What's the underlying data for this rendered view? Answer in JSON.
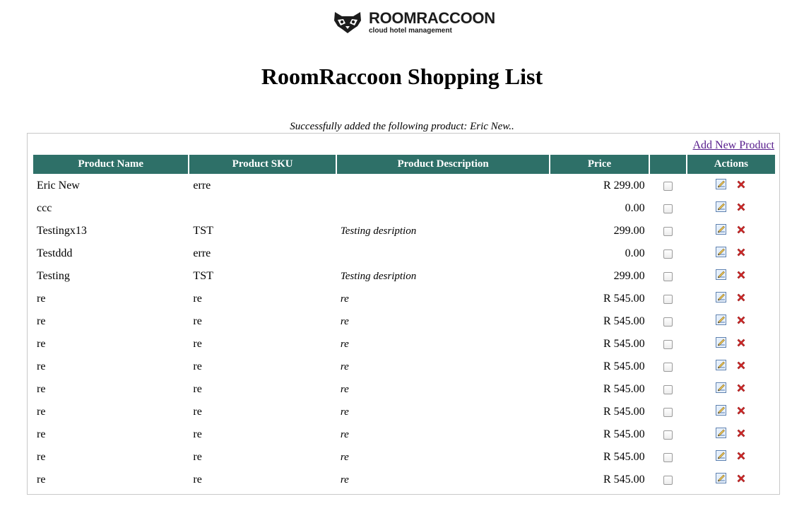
{
  "brand": {
    "name": "ROOMRACCOON",
    "tagline": "cloud hotel management"
  },
  "page_title": "RoomRaccoon Shopping List",
  "status_message": "Successfully added the following product: Eric New..",
  "add_link_label": "Add New Product",
  "table": {
    "headers": [
      "Product Name",
      "Product SKU",
      "Product Description",
      "Price",
      "",
      "Actions"
    ],
    "rows": [
      {
        "name": "Eric New",
        "sku": "erre",
        "description": "",
        "price": "R 299.00",
        "checked": false
      },
      {
        "name": "ccc",
        "sku": "",
        "description": "",
        "price": "0.00",
        "checked": false
      },
      {
        "name": "Testingx13",
        "sku": "TST",
        "description": "Testing desription",
        "price": "299.00",
        "checked": false
      },
      {
        "name": "Testddd",
        "sku": "erre",
        "description": "",
        "price": "0.00",
        "checked": false
      },
      {
        "name": "Testing",
        "sku": "TST",
        "description": "Testing desription",
        "price": "299.00",
        "checked": false
      },
      {
        "name": "re",
        "sku": "re",
        "description": "re",
        "price": "R 545.00",
        "checked": false
      },
      {
        "name": "re",
        "sku": "re",
        "description": "re",
        "price": "R 545.00",
        "checked": false
      },
      {
        "name": "re",
        "sku": "re",
        "description": "re",
        "price": "R 545.00",
        "checked": false
      },
      {
        "name": "re",
        "sku": "re",
        "description": "re",
        "price": "R 545.00",
        "checked": false
      },
      {
        "name": "re",
        "sku": "re",
        "description": "re",
        "price": "R 545.00",
        "checked": false
      },
      {
        "name": "re",
        "sku": "re",
        "description": "re",
        "price": "R 545.00",
        "checked": false
      },
      {
        "name": "re",
        "sku": "re",
        "description": "re",
        "price": "R 545.00",
        "checked": false
      },
      {
        "name": "re",
        "sku": "re",
        "description": "re",
        "price": "R 545.00",
        "checked": false
      },
      {
        "name": "re",
        "sku": "re",
        "description": "re",
        "price": "R 545.00",
        "checked": false
      }
    ],
    "row_actions": [
      {
        "name": "edit-icon",
        "label": "edit"
      },
      {
        "name": "delete-icon",
        "label": "delete"
      }
    ]
  },
  "colors": {
    "header_bg": "#2e7068",
    "link": "#551a8b",
    "delete": "#d62b2b"
  }
}
